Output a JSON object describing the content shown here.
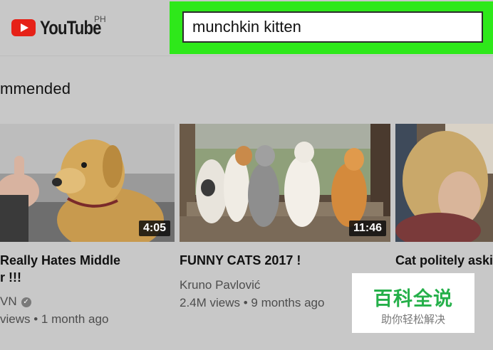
{
  "header": {
    "logo_text": "YouTube",
    "region": "PH",
    "search_value": "munchkin kitten"
  },
  "section": {
    "title": "mmended"
  },
  "videos": [
    {
      "title_line1": "Really Hates Middle",
      "title_line2": "r !!!",
      "channel": "VN",
      "verified": true,
      "meta": "views • 1 month ago",
      "duration": "4:05"
    },
    {
      "title_line1": "FUNNY CATS 2017 !",
      "title_line2": "",
      "channel": "Kruno Pavlović",
      "verified": false,
      "meta": "2.4M views • 9 months ago",
      "duration": "11:46"
    },
    {
      "title_line1": "Cat politely aski",
      "title_line2": "",
      "channel": "",
      "verified": false,
      "meta": "",
      "duration": ""
    }
  ],
  "watermark": {
    "main": "百科全说",
    "sub": "助你轻松解决"
  },
  "colors": {
    "highlight": "#2ee81a",
    "logo_red": "#e62117",
    "watermark_green": "#25b04a"
  }
}
